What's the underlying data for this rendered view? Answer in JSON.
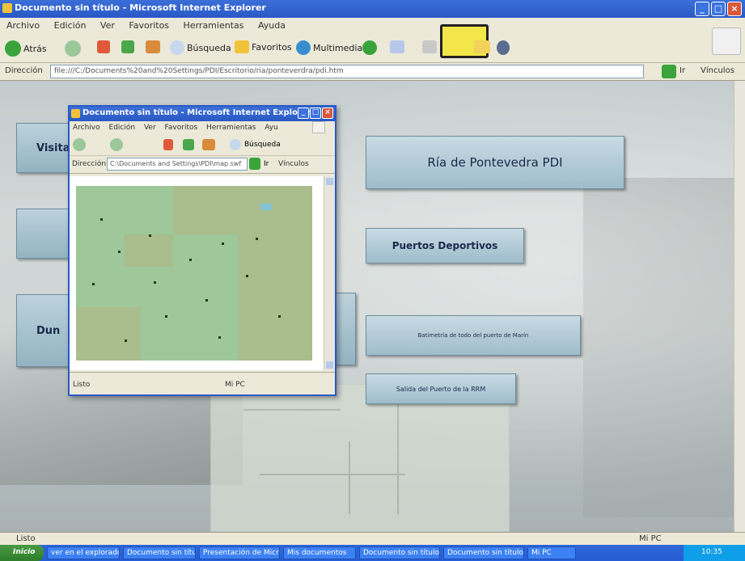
{
  "window": {
    "title": "Documento sin título - Microsoft Internet Explorer"
  },
  "menubar": [
    "Archivo",
    "Edición",
    "Ver",
    "Favoritos",
    "Herramientas",
    "Ayuda"
  ],
  "toolbar": {
    "back": "Atrás",
    "search": "Búsqueda",
    "favorites": "Favoritos",
    "multimedia": "Multimedia"
  },
  "addressbar": {
    "label": "Dirección",
    "url": "file:///C:/Documents%20and%20Settings/PDI/Escritorio/ria/ponteverdra/pdi.htm",
    "go": "Ir",
    "links": "Vínculos"
  },
  "buttons": {
    "main": "Ría de Pontevedra PDI",
    "sports_ports": "Puertos Deportivos",
    "depth": "Batimetría de todo del puerto de Marín",
    "exit": "Salida del Puerto de la RRM",
    "visitas": "Visita",
    "dun": "Dun"
  },
  "popup": {
    "title": "Documento sin título - Microsoft Internet Explorer",
    "menubar": [
      "Archivo",
      "Edición",
      "Ver",
      "Favoritos",
      "Herramientas",
      "Ayu"
    ],
    "toolbar_search": "Búsqueda",
    "address_label": "Dirección",
    "url": "C:\\Documents and Settings\\PDI\\map.swf",
    "go": "Ir",
    "links": "Vínculos",
    "status_left": "Listo",
    "status_right": "Mi PC"
  },
  "statusbar": {
    "left": "Listo",
    "right": "Mi PC"
  },
  "taskbar": {
    "start": "Inicio",
    "tasks": [
      "ver en el explorador",
      "Documento sin título",
      "Presentación de Microsoft",
      "Mis documentos",
      "Documento sin título",
      "Documento sin título",
      "Mi PC"
    ],
    "time": "10:35"
  },
  "colors": {
    "xp_blue": "#2a59c6",
    "button_fill": "#a8c4d2",
    "map_green": "#9ec79a"
  }
}
